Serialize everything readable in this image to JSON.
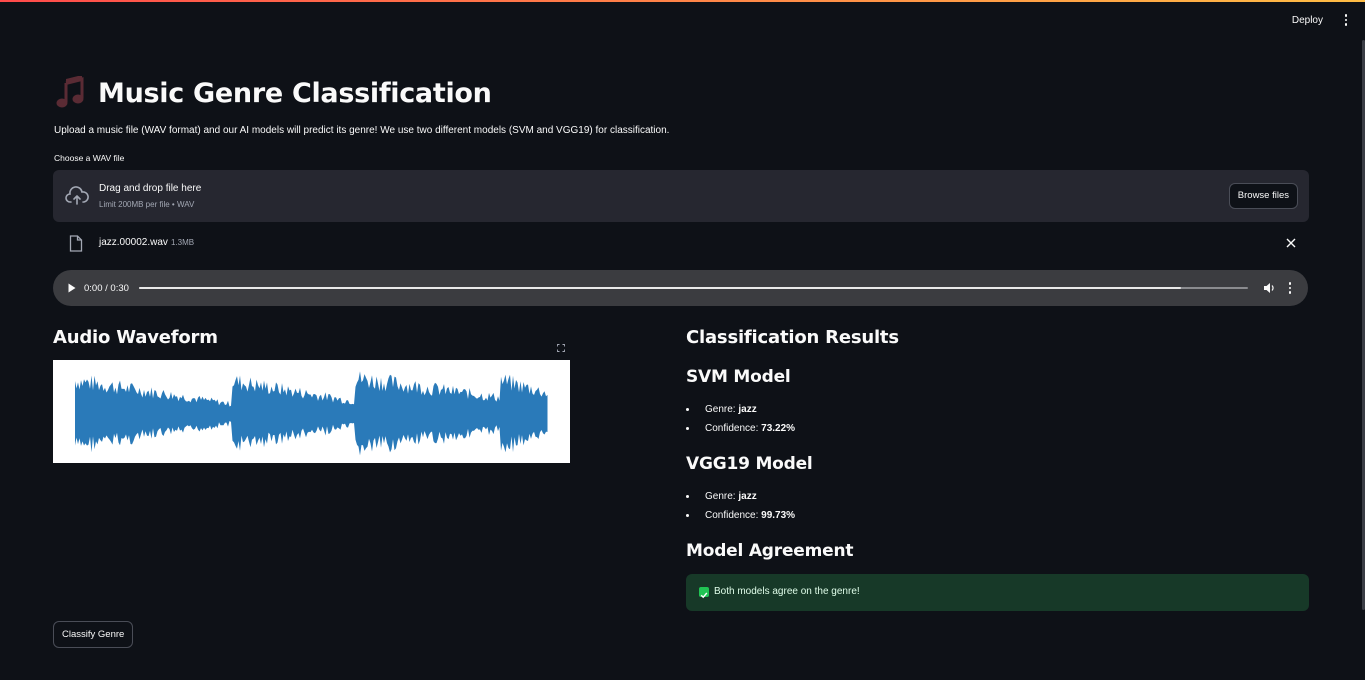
{
  "header": {
    "deploy_label": "Deploy",
    "menu_icon": "kebab-menu-icon",
    "accent_colors": [
      "#ff4b4b",
      "#ffbd45"
    ]
  },
  "page": {
    "title_icon": "musical-notes-emoji",
    "title": "Music Genre Classification",
    "subtitle": "Upload a music file (WAV format) and our AI models will predict its genre! We use two different models (SVM and VGG19) for classification."
  },
  "uploader": {
    "label": "Choose a WAV file",
    "drop_title": "Drag and drop file here",
    "drop_limit": "Limit 200MB per file • WAV",
    "browse_label": "Browse files",
    "icon": "cloud-upload-icon"
  },
  "uploaded_file": {
    "name": "jazz.00002.wav",
    "size": "1.3MB",
    "icon": "file-icon",
    "remove_icon": "close-icon"
  },
  "audio": {
    "time": "0:00 / 0:30",
    "progress": 0.94
  },
  "waveform": {
    "heading": "Audio Waveform",
    "color": "#2a7ab9"
  },
  "results": {
    "heading": "Classification Results",
    "svm": {
      "heading": "SVM Model",
      "genre_label": "Genre: ",
      "genre": "jazz",
      "confidence_label": "Confidence: ",
      "confidence": "73.22%"
    },
    "vgg": {
      "heading": "VGG19 Model",
      "genre_label": "Genre: ",
      "genre": "jazz",
      "confidence_label": "Confidence: ",
      "confidence": "99.73%"
    },
    "agreement": {
      "heading": "Model Agreement",
      "message": "Both models agree on the genre!",
      "color": "#21c354"
    }
  },
  "actions": {
    "classify_label": "Classify Genre"
  }
}
